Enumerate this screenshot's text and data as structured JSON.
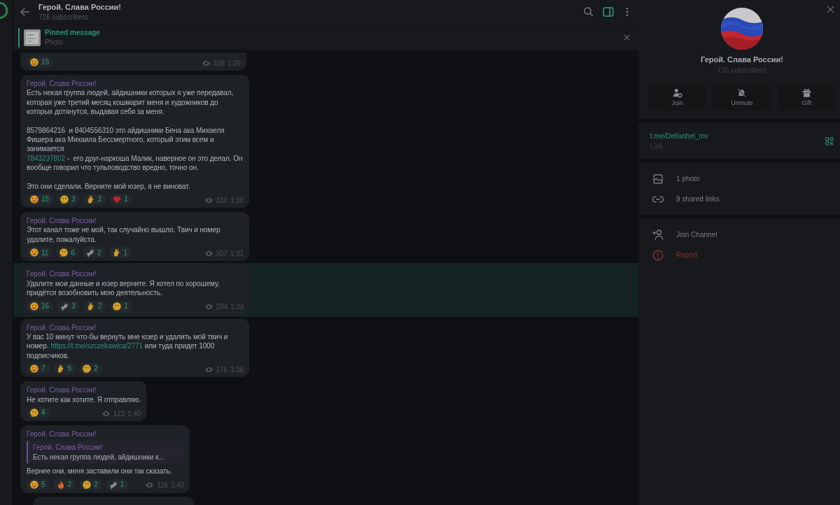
{
  "chat": {
    "title": "Герой. Слава России!",
    "subscribers": "726 subscribers",
    "panel_toggle": {
      "on": true
    }
  },
  "pinned": {
    "label": "Pinned message",
    "text": "Photo"
  },
  "messages": [
    {
      "partial": true,
      "highlighted": false,
      "reactions": [
        {
          "kind": "heart-face",
          "count": "15"
        }
      ],
      "views": "328",
      "time": "1:29"
    },
    {
      "partial": false,
      "highlighted": false,
      "author": "Герой. Слава России!",
      "paragraphs": [
        [
          {
            "text": "Есть некая группа людей, айдишники которых я уже передавал, которая уже третий месяц кошмарит меня и художников до которых дотянутся, выдавая себя за меня."
          }
        ],
        [
          {
            "text": "8579864216  и 8404556310 это айдишники Бена ака Михаеля Фишера ака Михаила Бессмертного, который этим всем и занимается\n"
          },
          {
            "text": "7843237802",
            "kind": "link"
          },
          {
            "text": " -  его друг-наркоша Малик, наверное он это делал. Он вообще говорил что тульповодство вредно, точно он."
          }
        ],
        [
          {
            "text": "Это они сделали. Верните мой юзер, я не виноват."
          }
        ]
      ],
      "reactions": [
        {
          "kind": "heart-face",
          "count": "15"
        },
        {
          "kind": "thinking",
          "count": "3"
        },
        {
          "kind": "ok-hand",
          "count": "2"
        },
        {
          "kind": "heart",
          "count": "1"
        }
      ],
      "views": "310",
      "time": "1:30"
    },
    {
      "partial": false,
      "highlighted": false,
      "author": "Герой. Слава России!",
      "paragraphs": [
        [
          {
            "text": "Этот канал тоже не мой, так случайно вышло. Твич и номер удалите, пожалуйста."
          }
        ]
      ],
      "reactions": [
        {
          "kind": "heart-face",
          "count": "11"
        },
        {
          "kind": "thinking",
          "count": "6"
        },
        {
          "kind": "dove",
          "count": "2"
        },
        {
          "kind": "ok-hand",
          "count": "1"
        }
      ],
      "views": "307",
      "time": "1:31"
    },
    {
      "partial": false,
      "highlighted": true,
      "author": "Герой. Слава России!",
      "paragraphs": [
        [
          {
            "text": "Удалите мои данные и юзер верните. Я хотел по хорошему, придётся возобновить мою деятельность."
          }
        ]
      ],
      "reactions": [
        {
          "kind": "heart-face",
          "count": "16"
        },
        {
          "kind": "dove",
          "count": "3"
        },
        {
          "kind": "ok-hand",
          "count": "2"
        },
        {
          "kind": "thinking",
          "count": "1"
        }
      ],
      "views": "284",
      "time": "1:33"
    },
    {
      "partial": false,
      "highlighted": false,
      "author": "Герой. Слава России!",
      "paragraphs": [
        [
          {
            "text": "У вас 10 минут что-бы вернуть мне юзер и удалить мой твич и номер. "
          },
          {
            "text": "https://t.me/szczekawica/2771",
            "kind": "link"
          },
          {
            "text": " или туда придет 1000 подписчиков."
          }
        ]
      ],
      "reactions": [
        {
          "kind": "heart-face",
          "count": "7"
        },
        {
          "kind": "ok-hand",
          "count": "5"
        },
        {
          "kind": "thinking",
          "count": "2"
        }
      ],
      "views": "176",
      "time": "1:38"
    },
    {
      "partial": false,
      "highlighted": false,
      "author": "Герой. Слава России!",
      "paragraphs": [
        [
          {
            "text": "Не хотите как хотите. Я отправляю."
          }
        ]
      ],
      "reactions": [
        {
          "kind": "thinking",
          "count": "4"
        }
      ],
      "views": "123",
      "time": "1:40"
    },
    {
      "partial": false,
      "highlighted": false,
      "author": "Герой. Слава России!",
      "reply": {
        "author": "Герой. Слава России!",
        "text": "Есть некая группа людей, айдишники к..."
      },
      "paragraphs": [
        [
          {
            "text": "Вернее они, меня заставили они так сказать."
          }
        ]
      ],
      "reactions": [
        {
          "kind": "heart-face",
          "count": "5"
        },
        {
          "kind": "fire",
          "count": "2"
        },
        {
          "kind": "thinking",
          "count": "2"
        },
        {
          "kind": "dove",
          "count": "1"
        }
      ],
      "views": "116",
      "time": "1:40"
    }
  ],
  "info": {
    "title": "Герой. Слава России!",
    "subscribers": "726 subscribers",
    "actions": [
      {
        "kind": "join",
        "label": "Join"
      },
      {
        "kind": "unmute",
        "label": "Unmute"
      },
      {
        "kind": "gift",
        "label": "Gift"
      }
    ],
    "link": {
      "url": "t.me/Dellanhel_mv",
      "label": "Link"
    },
    "media": [
      {
        "label": "1 photo"
      },
      {
        "kind": "links",
        "label": "9 shared links"
      }
    ],
    "menu": [
      {
        "kind": "join",
        "label": "Join Channel"
      },
      {
        "kind": "report",
        "label": "Report"
      }
    ]
  }
}
